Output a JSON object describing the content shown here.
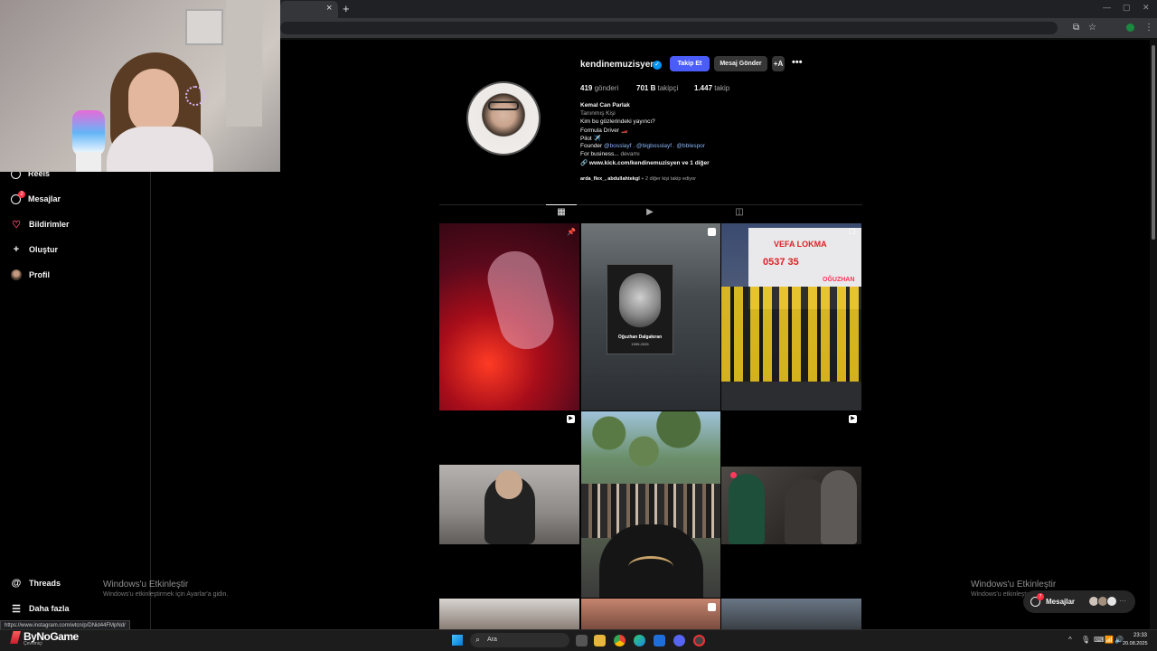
{
  "browser": {
    "tab_close": "×",
    "new_tab": "+",
    "win_min": "—",
    "win_max": "▢",
    "win_close": "✕",
    "toolbar_icons": [
      "⧉",
      "☆",
      "⋮"
    ]
  },
  "sidebar": {
    "items": [
      {
        "label": "Reels",
        "icon": "reels-icon"
      },
      {
        "label": "Mesajlar",
        "icon": "messages-icon",
        "badge": "2"
      },
      {
        "label": "Bildirimler",
        "icon": "heart-icon"
      },
      {
        "label": "Oluştur",
        "icon": "plus-icon"
      },
      {
        "label": "Profil",
        "icon": "avatar-icon"
      }
    ],
    "bottom": [
      {
        "label": "Threads",
        "icon": "threads-icon"
      },
      {
        "label": "Daha fazla",
        "icon": "menu-icon"
      }
    ]
  },
  "status_url": "https://www.instagram.com/wtcn/p/DNid44FMpNd/",
  "watermark": {
    "title": "Windows'u Etkinleştir",
    "subtitle": "Windows'u etkinleştirmek için Ayarlar'a gidin."
  },
  "profile": {
    "username": "kendinemuzisyen",
    "verified_mark": "✓",
    "follow_label": "Takip Et",
    "message_label": "Mesaj Gönder",
    "similar_label": "+A",
    "more_label": "•••",
    "stats": {
      "posts_value": "419",
      "posts_label": "gönderi",
      "followers_value": "701 B",
      "followers_label": "takipçi",
      "following_value": "1.447",
      "following_label": "takip"
    },
    "bio": {
      "name": "Kemal Can Parlak",
      "category": "Tanınmış Kişi",
      "line1": "Kim bu gözlerindeki yayıncı?",
      "line2": "Formula Driver 🏎️",
      "line3": "Pilot ✈️",
      "founder_prefix": "Founder",
      "founder_links": "@bosslayf . @bigbosslayf . @bblespor",
      "business": "For business...",
      "more": "devamı",
      "link": "www.kick.com/kendinemuzisyen ve 1 diğer",
      "link_icon": "🔗"
    },
    "followed_by_names": "arda_flex_, abdullahtekgl",
    "followed_by_rest": "+ 2 diğer kişi takip ediyor"
  },
  "tabs": [
    {
      "name": "posts",
      "glyph": "▦"
    },
    {
      "name": "reels",
      "glyph": "▶"
    },
    {
      "name": "tagged",
      "glyph": "◫"
    }
  ],
  "tiles": {
    "t2_caption": "Oğuzhan Dalgakıran",
    "t2_years": "1999-2025",
    "t3_name": "VEFA LOKMA",
    "t3_phone": "0537 35",
    "t3_sign": "OĞUZHAN",
    "pin_glyph": "📌",
    "reel_glyph": "▶",
    "multi_glyph": "❐"
  },
  "messages_float": {
    "label": "Mesajlar",
    "badge": "7",
    "more": "···"
  },
  "taskbar": {
    "brand": "ByNoGame",
    "brand_sub": "Çevrimiçi",
    "search_icon": "⌕",
    "search_label": "Ara",
    "time": "23:33",
    "date": "20.08.2025",
    "tray": [
      "^",
      "🎙",
      "⌨",
      "📶",
      "🔊"
    ]
  }
}
